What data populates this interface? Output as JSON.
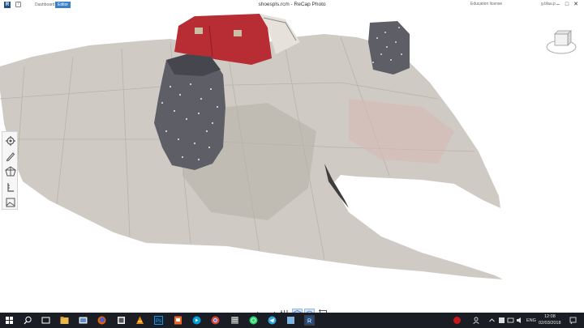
{
  "app": {
    "logo_letter": "R",
    "help_label": "?",
    "title": "shoespls.rcm - ReCap Photo",
    "license": "Education license",
    "user": "g.blau.p"
  },
  "tabs": [
    {
      "label": "Dashboard"
    },
    {
      "label": "Editor"
    }
  ],
  "window_controls": {
    "minimize": "–",
    "maximize": "□",
    "close": "✕"
  },
  "left_toolbar": [
    {
      "icon": "gear-icon"
    },
    {
      "icon": "pencil-icon"
    },
    {
      "icon": "mesh-icon"
    },
    {
      "icon": "measure-icon"
    },
    {
      "icon": "image-icon"
    }
  ],
  "bottom_toolbar": [
    {
      "icon": "undo-icon"
    },
    {
      "icon": "redo-icon"
    },
    {
      "icon": "sliders-icon"
    },
    {
      "icon": "cube-view-icon"
    },
    {
      "icon": "orbit-icon"
    },
    {
      "icon": "crop-icon"
    }
  ],
  "taskbar": {
    "apps": [
      "start-icon",
      "search-icon",
      "task-view-icon",
      "file-explorer-icon",
      "app-icon",
      "firefox-icon",
      "app-icon",
      "vlc-icon",
      "photoshop-icon",
      "app-icon",
      "app-icon",
      "chrome-icon",
      "app-icon",
      "app-icon",
      "whatsapp-icon",
      "telegram-icon",
      "app-icon",
      "recap-icon"
    ],
    "tray": {
      "language": "ENG",
      "time": "12:08",
      "date": "02/03/2018"
    }
  },
  "colors": {
    "accent": "#3f7fc5",
    "taskbar": "#1a1d24",
    "floor": "#cfcbc4",
    "shoe": "#5d5e66",
    "bag": "#b72d33"
  }
}
